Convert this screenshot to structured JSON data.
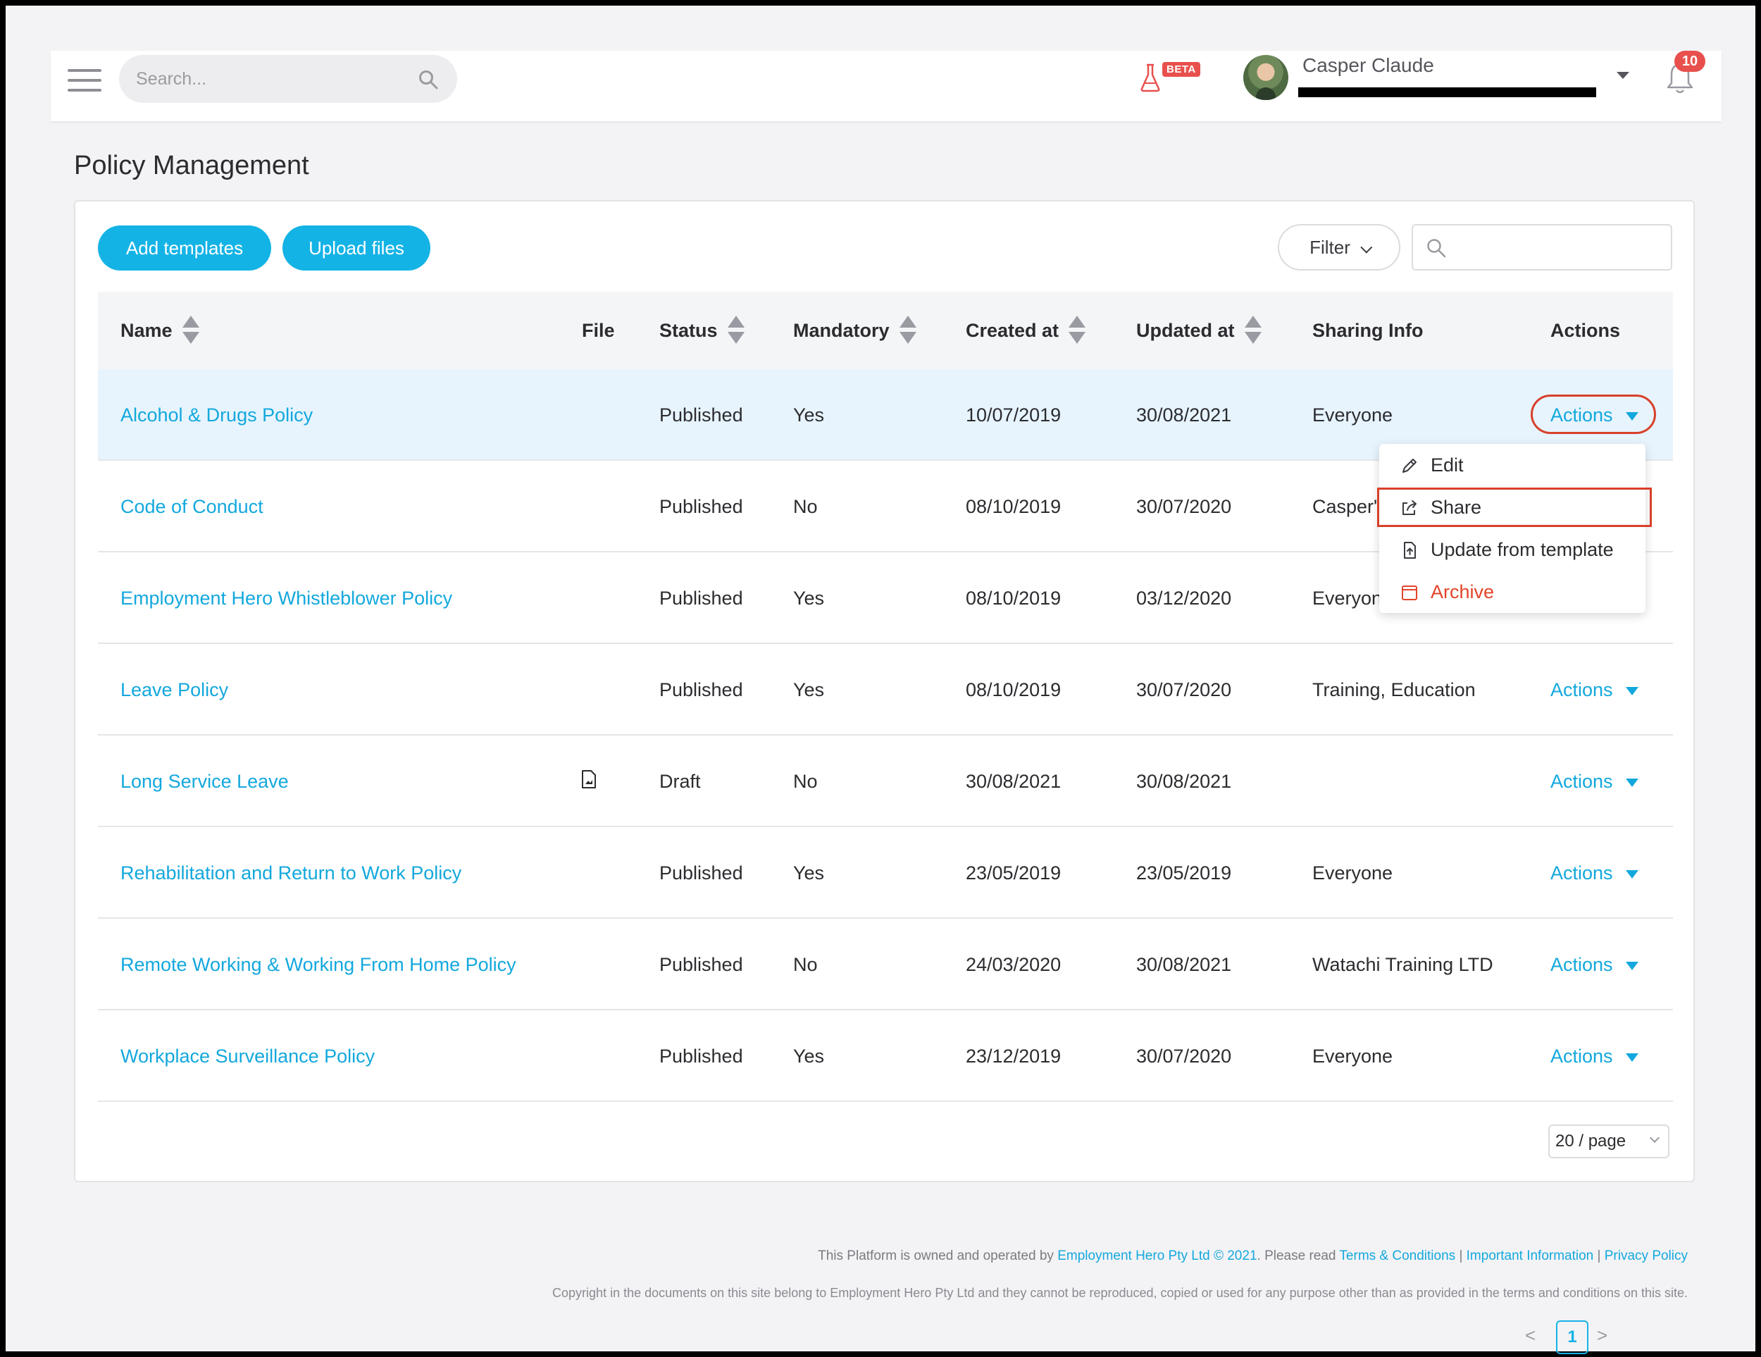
{
  "topbar": {
    "search_placeholder": "Search...",
    "beta_label": "BETA",
    "user_name": "Casper Claude",
    "notification_count": "10"
  },
  "page": {
    "title": "Policy Management"
  },
  "toolbar": {
    "add_templates": "Add templates",
    "upload_files": "Upload files",
    "filter": "Filter"
  },
  "table": {
    "headers": [
      "Name",
      "File",
      "Status",
      "Mandatory",
      "Created at",
      "Updated at",
      "Sharing Info",
      "Actions"
    ],
    "rows": [
      {
        "name": "Alcohol & Drugs Policy",
        "status": "Published",
        "mandatory": "Yes",
        "created": "10/07/2019",
        "updated": "30/08/2021",
        "sharing": "Everyone",
        "actions": "Actions"
      },
      {
        "name": "Code of Conduct",
        "status": "Published",
        "mandatory": "No",
        "created": "08/10/2019",
        "updated": "30/07/2020",
        "sharing": "Casper'",
        "actions": ""
      },
      {
        "name": "Employment Hero Whistleblower Policy",
        "status": "Published",
        "mandatory": "Yes",
        "created": "08/10/2019",
        "updated": "03/12/2020",
        "sharing": "Everyon",
        "actions": ""
      },
      {
        "name": "Leave Policy",
        "status": "Published",
        "mandatory": "Yes",
        "created": "08/10/2019",
        "updated": "30/07/2020",
        "sharing": "Training, Education",
        "actions": "Actions"
      },
      {
        "name": "Long Service Leave",
        "status": "Draft",
        "mandatory": "No",
        "created": "30/08/2021",
        "updated": "30/08/2021",
        "sharing": "",
        "actions": "Actions"
      },
      {
        "name": "Rehabilitation and Return to Work Policy",
        "status": "Published",
        "mandatory": "Yes",
        "created": "23/05/2019",
        "updated": "23/05/2019",
        "sharing": "Everyone",
        "actions": "Actions"
      },
      {
        "name": "Remote Working & Working From Home Policy",
        "status": "Published",
        "mandatory": "No",
        "created": "24/03/2020",
        "updated": "30/08/2021",
        "sharing": "Watachi Training LTD",
        "actions": "Actions"
      },
      {
        "name": "Workplace Surveillance Policy",
        "status": "Published",
        "mandatory": "Yes",
        "created": "23/12/2019",
        "updated": "30/07/2020",
        "sharing": "Everyone",
        "actions": "Actions"
      }
    ]
  },
  "dropdown": {
    "items": [
      {
        "label": "Edit",
        "icon": "pencil-icon"
      },
      {
        "label": "Share",
        "icon": "share-icon"
      },
      {
        "label": "Update from template",
        "icon": "file-upload-icon"
      },
      {
        "label": "Archive",
        "icon": "archive-icon"
      }
    ]
  },
  "pagination": {
    "prev": "<",
    "current": "1",
    "next": ">",
    "page_size": "20 / page"
  },
  "footer": {
    "line1_prefix": "This Platform is owned and operated by",
    "company_link": "Employment Hero Pty Ltd © 2021",
    "line1_mid": ". Please read",
    "terms_link": "Terms & Conditions",
    "sep": "|",
    "info_link": "Important Information",
    "privacy_link": "Privacy Policy",
    "line2": "Copyright in the documents on this site belong to Employment Hero Pty Ltd and they cannot be reproduced, copied or used for any purpose other than as provided in the terms and conditions on this site."
  },
  "colors": {
    "accent": "#14b3e6",
    "link": "#13a8dd",
    "danger": "#e2452b",
    "highlight": "#d8402a",
    "badge": "#e8504d"
  }
}
